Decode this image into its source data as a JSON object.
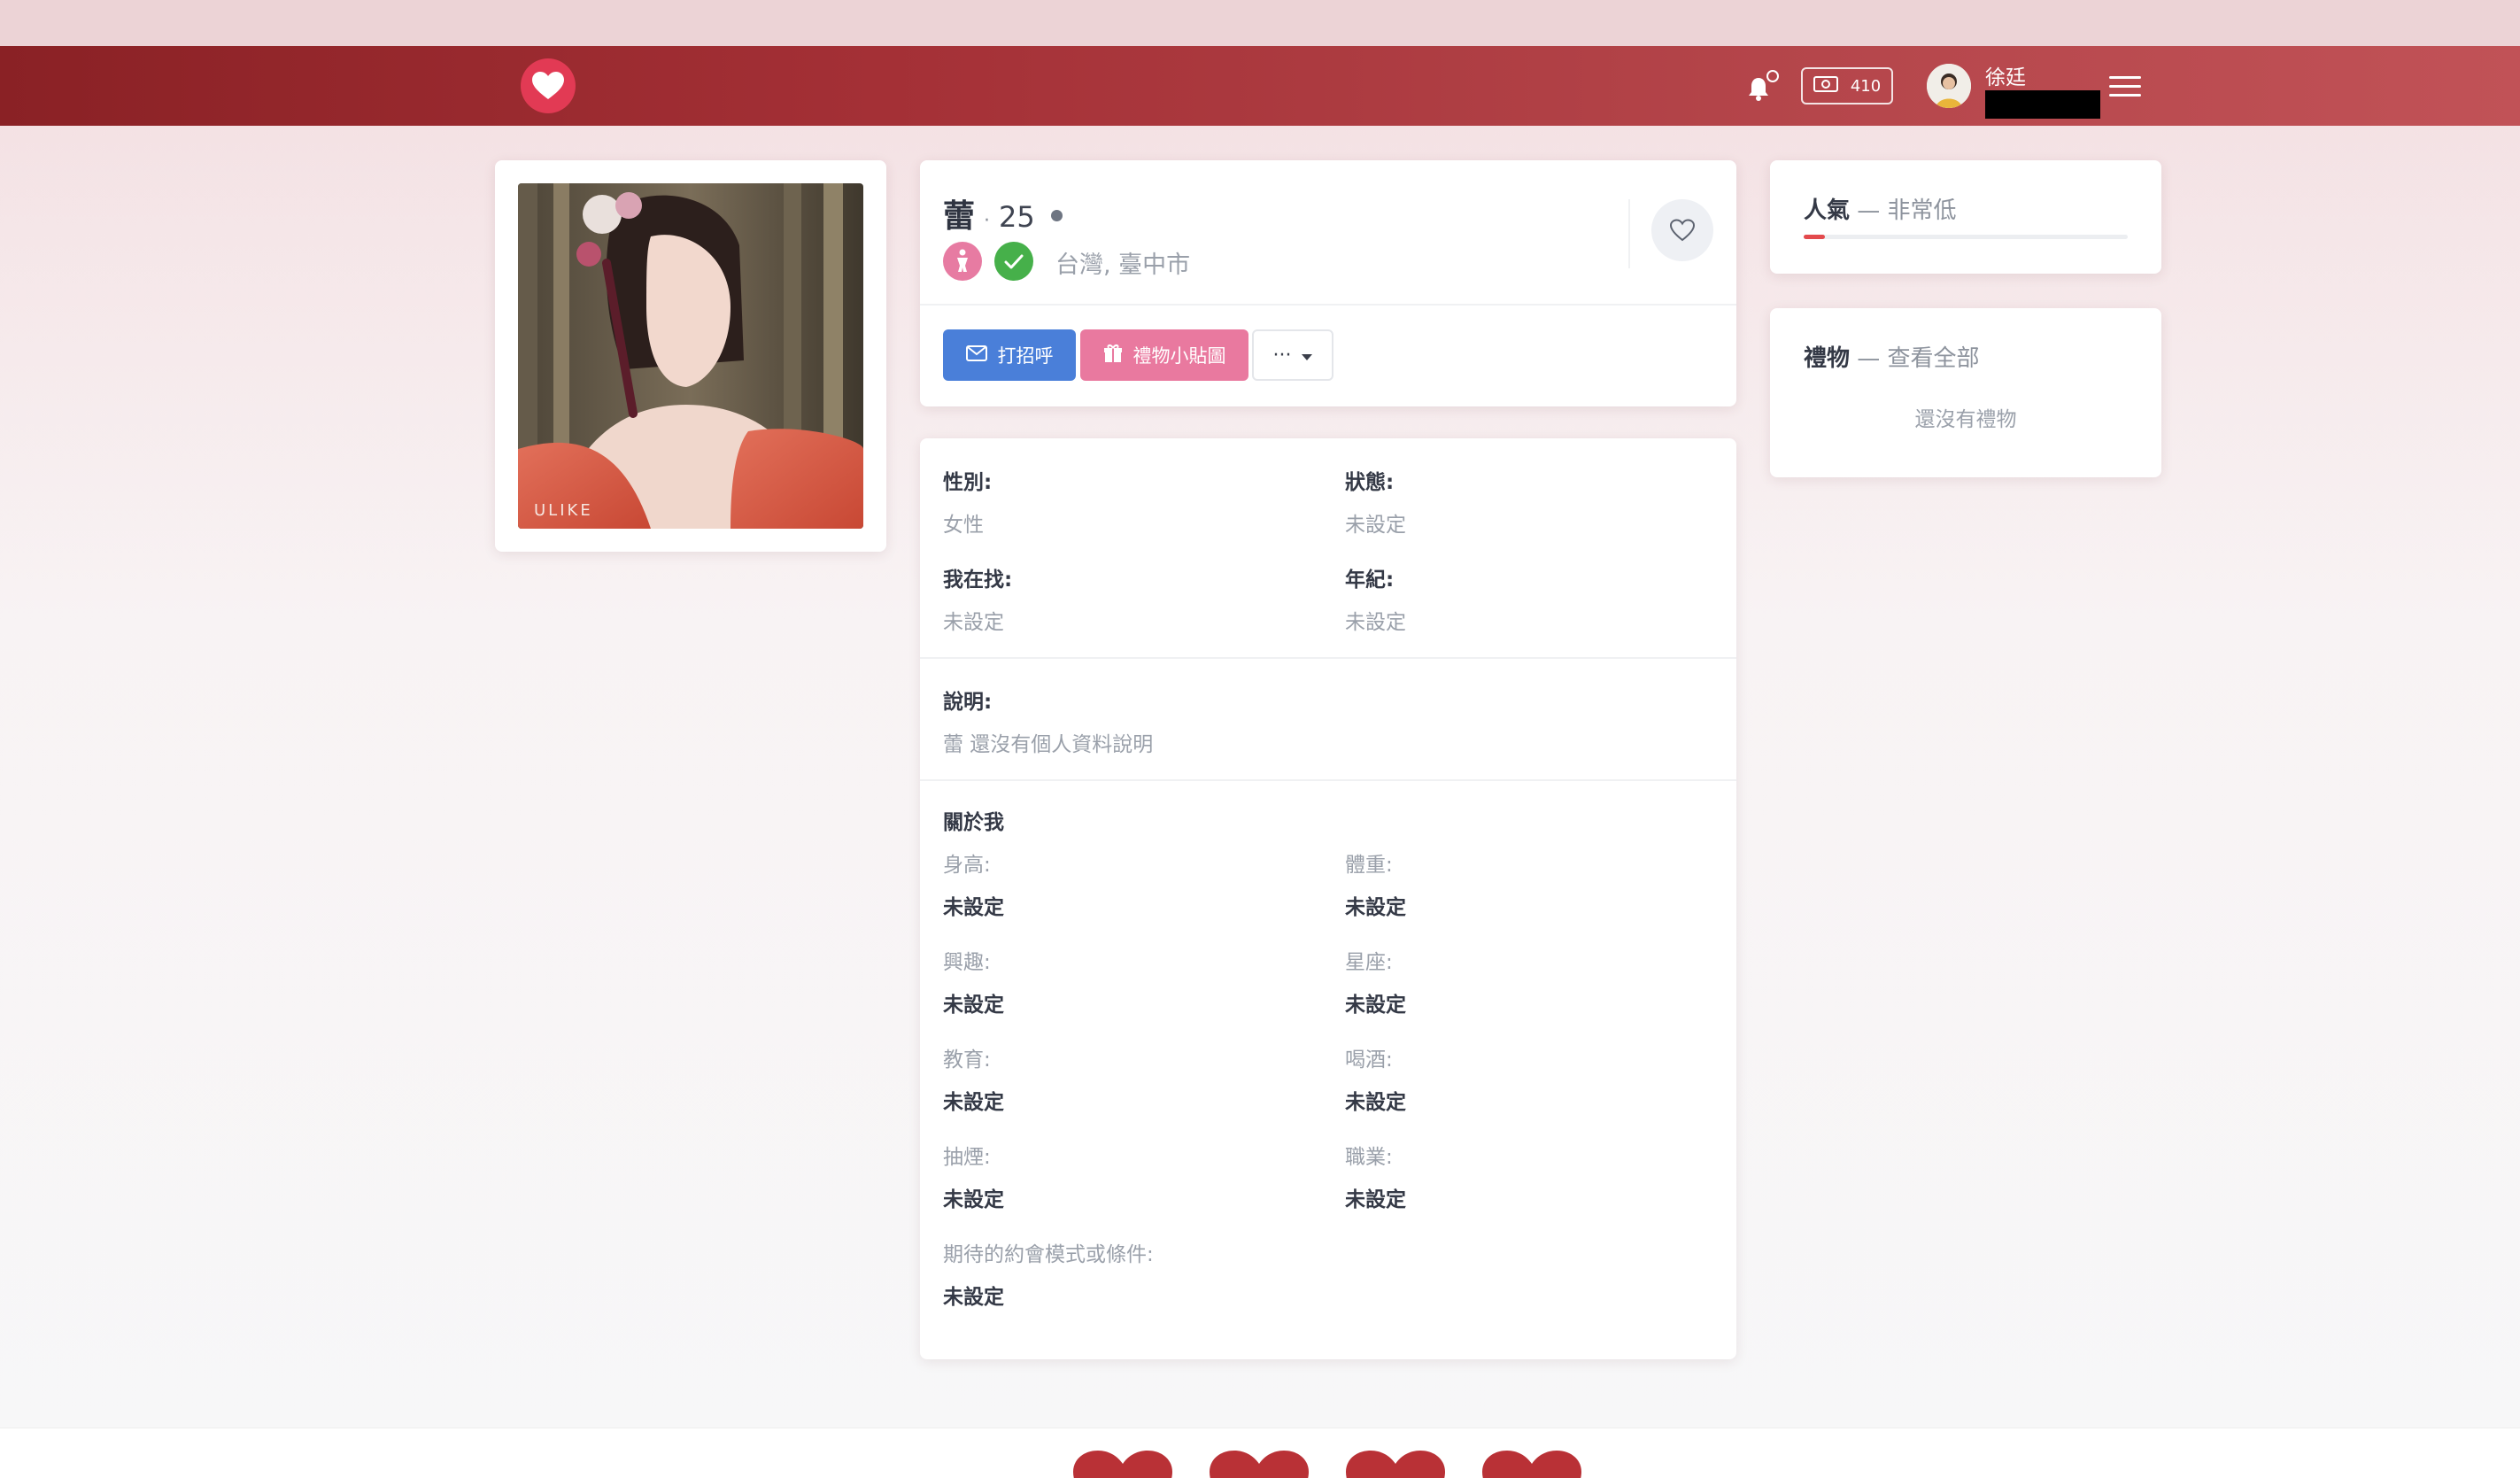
{
  "header": {
    "logo_icon": "heart-logo-icon",
    "notification_icon": "bell-icon",
    "wallet": {
      "icon": "money-icon",
      "amount": "410"
    },
    "user": {
      "name": "徐廷"
    },
    "menu_icon": "hamburger-menu-icon",
    "brand_color": "#a43036"
  },
  "profile": {
    "name": "蕾",
    "separator": "·",
    "age": "25",
    "location": "台灣, 臺中市",
    "actions": {
      "greet_label": "打招呼",
      "gift_label": "禮物小貼圖",
      "more_label": "···"
    }
  },
  "details": {
    "gender_label": "性別:",
    "gender_value": "女性",
    "status_label": "狀態:",
    "status_value": "未設定",
    "seeking_label": "我在找:",
    "seeking_value": "未設定",
    "age_label": "年紀:",
    "age_value": "未設定",
    "desc_label": "說明:",
    "desc_value": "蕾 還沒有個人資料說明",
    "about_heading": "關於我",
    "about": [
      {
        "label": "身高:",
        "value": "未設定"
      },
      {
        "label": "體重:",
        "value": "未設定"
      },
      {
        "label": "興趣:",
        "value": "未設定"
      },
      {
        "label": "星座:",
        "value": "未設定"
      },
      {
        "label": "教育:",
        "value": "未設定"
      },
      {
        "label": "喝酒:",
        "value": "未設定"
      },
      {
        "label": "抽煙:",
        "value": "未設定"
      },
      {
        "label": "職業:",
        "value": "未設定"
      },
      {
        "label": "期待的約會模式或條件:",
        "value": "未設定"
      }
    ]
  },
  "sidebar": {
    "popularity": {
      "title": "人氣",
      "dash": "—",
      "level": "非常低",
      "percent": 6.5
    },
    "gifts": {
      "title": "禮物",
      "dash": "—",
      "view_all": "查看全部",
      "empty": "還沒有禮物"
    }
  },
  "photo": {
    "watermark": "ULIKE"
  }
}
